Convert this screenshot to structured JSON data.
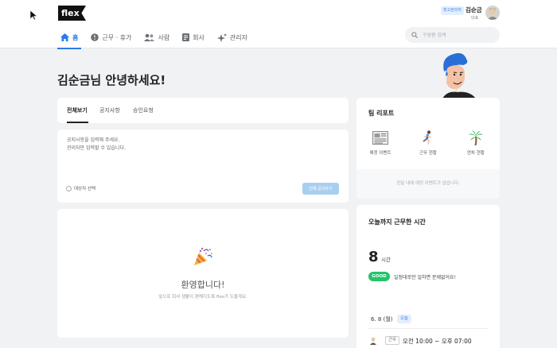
{
  "header": {
    "logo_text": "flex",
    "role_badge": "최고관리자",
    "user_name": "김순금",
    "user_title": "대표",
    "nav": [
      {
        "label": "홈",
        "icon": "home-icon",
        "active": true
      },
      {
        "label": "근무 · 휴가",
        "icon": "clock-icon",
        "active": false
      },
      {
        "label": "사람",
        "icon": "people-icon",
        "active": false
      },
      {
        "label": "회사",
        "icon": "document-icon",
        "active": false
      },
      {
        "label": "관리자",
        "icon": "sparkle-icon",
        "active": false
      }
    ],
    "search_placeholder": "구성원 검색"
  },
  "main": {
    "greeting": "김순금님 안녕하세요!",
    "tabs": [
      {
        "label": "전체보기",
        "active": true
      },
      {
        "label": "공지사항",
        "active": false
      },
      {
        "label": "승인요청",
        "active": false
      }
    ],
    "notice": {
      "line1": "공지사항을 입력해 주세요.",
      "line2": "관리자만 입력할 수 있습니다.",
      "target_label": "대상자 선택",
      "submit_label": "전체 공지하기"
    },
    "welcome": {
      "title": "환영합니다!",
      "subtitle": "앞으로 회사 생활이 편해지도록 flex가 도울게요."
    }
  },
  "team_report": {
    "title": "팀 리포트",
    "items": [
      {
        "label": "예정 이벤트",
        "icon": "newspaper-icon"
      },
      {
        "label": "근무 현황",
        "icon": "runner-icon"
      },
      {
        "label": "연차 현황",
        "icon": "palm-tree-icon"
      }
    ],
    "empty_text": "한달 내에 예정 이벤트가 없습니다."
  },
  "work_time": {
    "title": "오늘까지 근무한 시간",
    "hours": "8",
    "unit": "시간",
    "badge": "GOOD",
    "message": "일정대로만 일하면 문제없어요!",
    "date": "6. 8 (월)",
    "today_badge": "오늘",
    "type": "근무",
    "time_range": "오전 10:00 ~ 오후 07:00"
  },
  "colors": {
    "accent": "#2c7be5",
    "good": "#23c46b",
    "background": "#f1f2f4"
  }
}
